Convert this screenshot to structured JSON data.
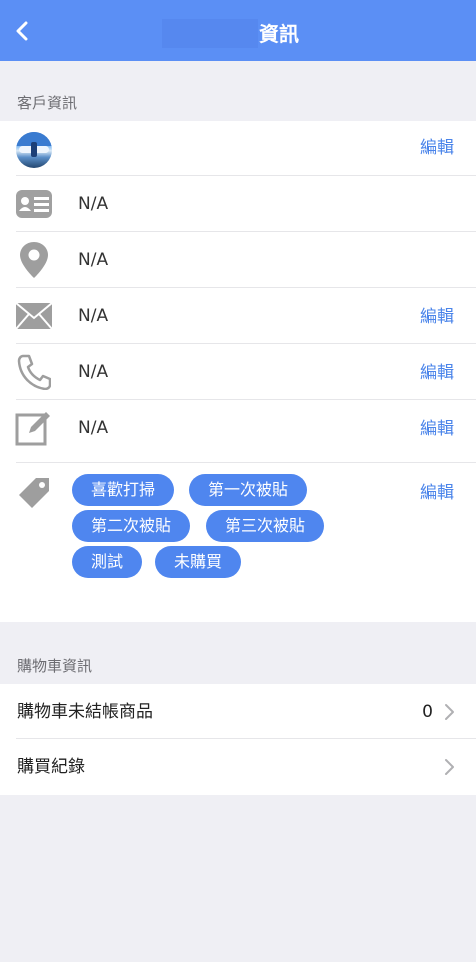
{
  "header": {
    "title": "資訊",
    "back_icon": "chevron-left-icon"
  },
  "customer_section": {
    "title": "客戶資訊",
    "edit_label": "編輯",
    "rows": [
      {
        "icon": "id-card-icon",
        "value": "N/A"
      },
      {
        "icon": "location-pin-icon",
        "value": "N/A"
      },
      {
        "icon": "envelope-icon",
        "value": "N/A"
      },
      {
        "icon": "phone-icon",
        "value": "N/A"
      },
      {
        "icon": "edit-note-icon",
        "value": "N/A"
      }
    ],
    "tags": [
      "喜歡打掃",
      "第一次被貼",
      "第二次被貼",
      "第三次被貼",
      "測試",
      "未購買"
    ]
  },
  "cart_section": {
    "title": "購物車資訊",
    "items": [
      {
        "label": "購物車未結帳商品",
        "value": "0"
      },
      {
        "label": "購買紀錄",
        "value": ""
      }
    ]
  },
  "colors": {
    "accent": "#5b8ff5",
    "tag_bg": "#4f86ef",
    "link": "#4a84ea",
    "background": "#efeff4",
    "icon_gray": "#9e9e9e"
  }
}
